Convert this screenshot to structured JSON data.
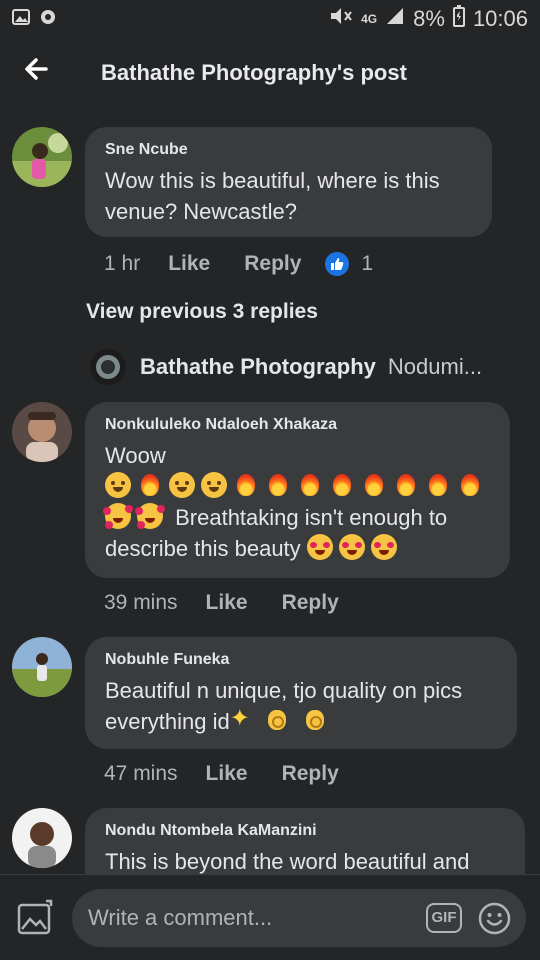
{
  "status_bar": {
    "network": "4G",
    "battery": "8%",
    "time": "10:06"
  },
  "header": {
    "title": "Bathathe Photography's post"
  },
  "comments": [
    {
      "author": "Sne Ncube",
      "text": "Wow this is beautiful, where is this venue? Newcastle?",
      "time": "1 hr",
      "like_label": "Like",
      "reply_label": "Reply",
      "reaction_count": "1"
    },
    {
      "author": "Nonkululeko Ndaloeh Xhakaza",
      "line1": "Woow",
      "line3_text": " Breathtaking isn't enough to",
      "line4_text": "describe this beauty",
      "time": "39 mins",
      "like_label": "Like",
      "reply_label": "Reply"
    },
    {
      "author": "Nobuhle Funeka",
      "line1": "Beautiful n unique, tjo quality on pics",
      "line2_text": "everything id",
      "time": "47 mins",
      "like_label": "Like",
      "reply_label": "Reply"
    },
    {
      "author": "Nondu Ntombela KaManzini",
      "text": "This is beyond the word beautiful and"
    }
  ],
  "view_previous": "View previous 3 replies",
  "reply_preview": {
    "author": "Bathathe Photography",
    "snippet": "Nodumi..."
  },
  "composer": {
    "placeholder": "Write a comment...",
    "gif_label": "GIF"
  },
  "colors": {
    "background": "#242526",
    "bubble": "#3a3b3c",
    "like_blue": "#1b74e4"
  }
}
